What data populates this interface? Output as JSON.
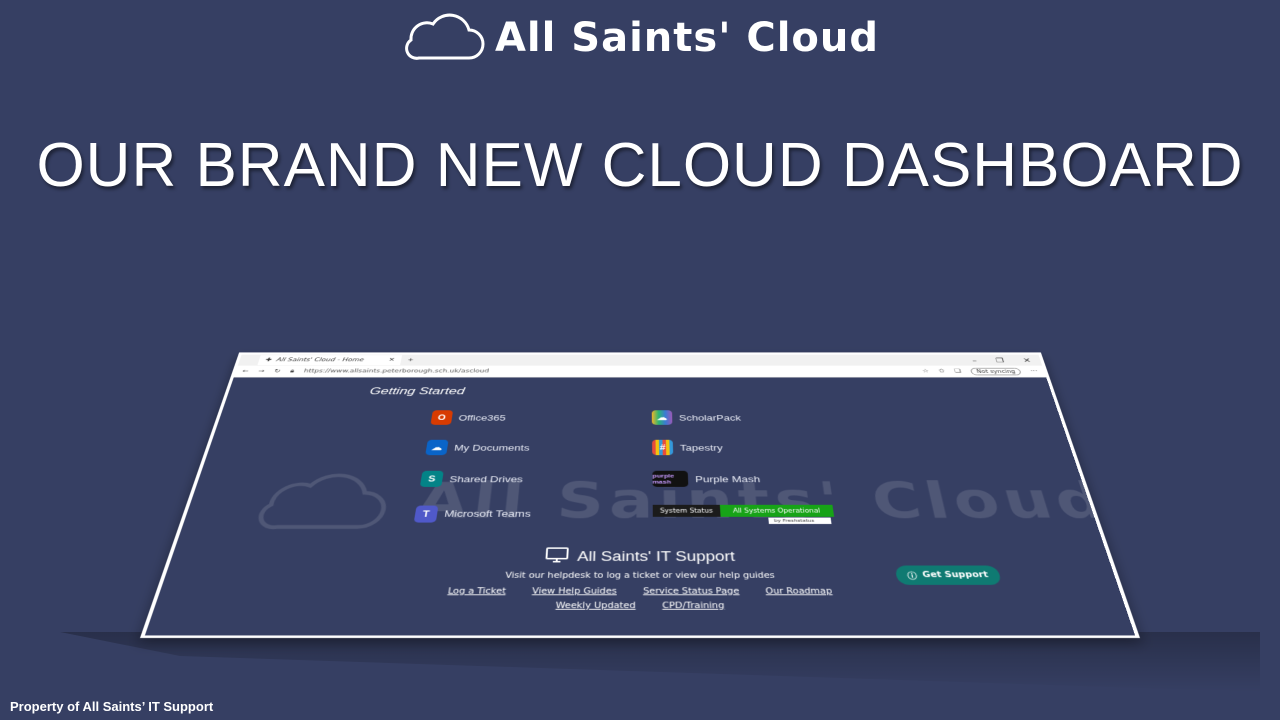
{
  "brand": {
    "name": "All Saints' Cloud"
  },
  "headline": "OUR BRAND NEW CLOUD DASHBOARD",
  "browser": {
    "tab_title": "All Saints' Cloud - Home",
    "url": "https://www.allsaints.peterborough.sch.uk/ascloud",
    "sync_label": "Not syncing"
  },
  "dashboard": {
    "getting_started": "Getting Started",
    "watermark": "All Saints' Cloud",
    "left_links": [
      {
        "label": "Office365",
        "icon": "office365-icon",
        "color": "#d83b01"
      },
      {
        "label": "My Documents",
        "icon": "onedrive-icon",
        "color": "#0a64c8"
      },
      {
        "label": "Shared Drives",
        "icon": "sharepoint-icon",
        "color": "#038387"
      },
      {
        "label": "Microsoft Teams",
        "icon": "teams-icon",
        "color": "#5059c9"
      }
    ],
    "right_links": [
      {
        "label": "ScholarPack",
        "icon": "scholarpack-icon",
        "color": "#7a5cc8"
      },
      {
        "label": "Tapestry",
        "icon": "tapestry-icon",
        "color": "#c0392b"
      },
      {
        "label": "Purple Mash",
        "icon": "purple-mash-icon",
        "color": "#111111",
        "badge": "purple mash"
      }
    ],
    "status_widget": {
      "label": "System Status",
      "value": "All Systems Operational",
      "by": "by Freshstatus"
    }
  },
  "support": {
    "title": "All Saints' IT Support",
    "subtitle": "Visit our helpdesk to log a ticket or view our help guides",
    "links": [
      "Log a Ticket",
      "View Help Guides",
      "Service Status Page",
      "Our Roadmap",
      "Weekly Updated",
      "CPD/Training"
    ],
    "button": "Get Support"
  },
  "footer_note": "Property of All Saints’ IT Support"
}
